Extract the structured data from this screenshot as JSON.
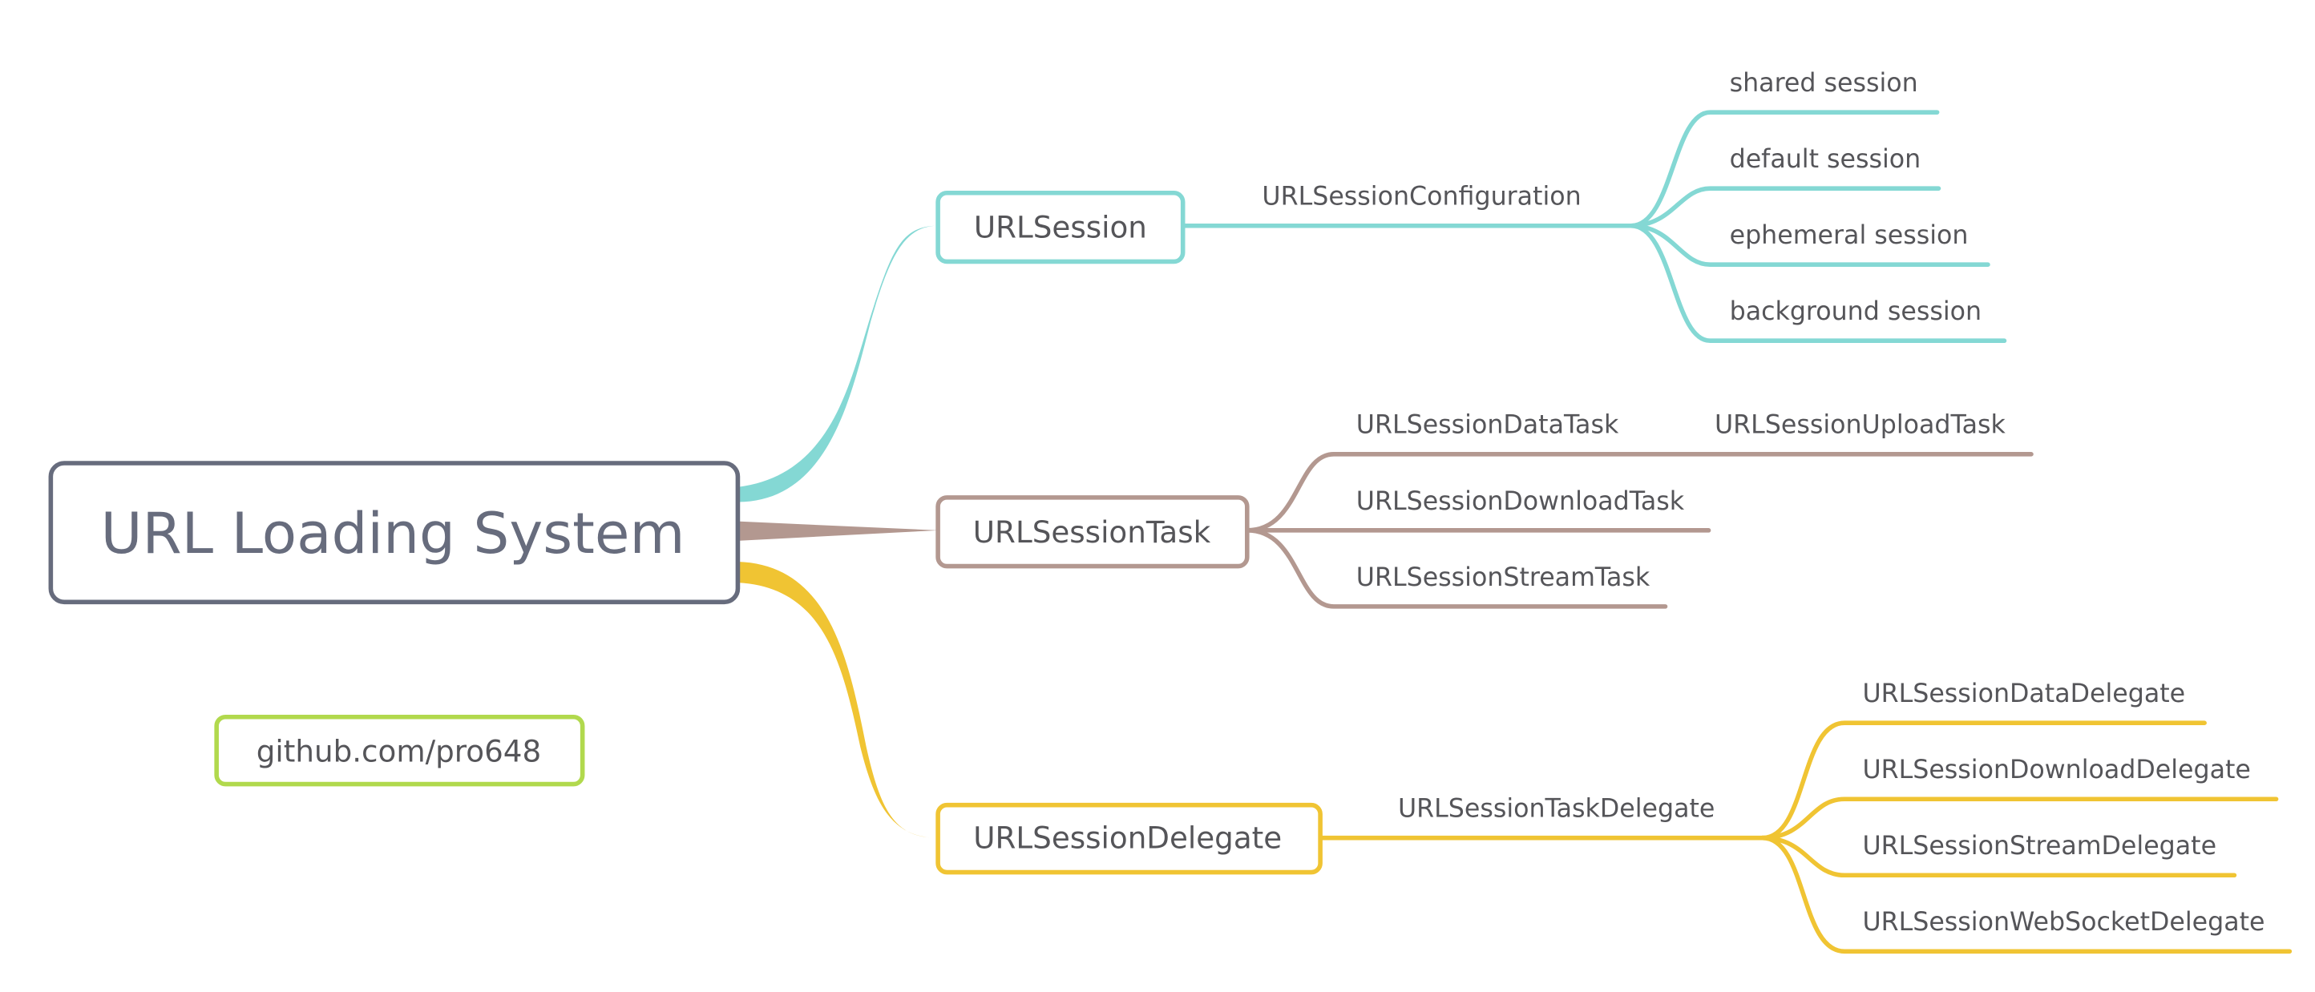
{
  "title": "URL Loading System",
  "colors": {
    "root": "#676C7D",
    "urlsession": "#84D8D4",
    "task": "#B39890",
    "delegate": "#F0C433",
    "floating": "#B1D94D",
    "text": "#555559"
  },
  "root": {
    "label": "URL Loading System"
  },
  "floating": {
    "label": "github.com/pro648"
  },
  "branches": [
    {
      "label": "URLSession",
      "children": [
        {
          "label": "URLSessionConfiguration",
          "children": [
            {
              "label": "shared session"
            },
            {
              "label": "default session"
            },
            {
              "label": "ephemeral session"
            },
            {
              "label": "background session"
            }
          ]
        }
      ]
    },
    {
      "label": "URLSessionTask",
      "children": [
        {
          "label": "URLSessionDataTask",
          "children": [
            {
              "label": "URLSessionUploadTask"
            }
          ]
        },
        {
          "label": "URLSessionDownloadTask"
        },
        {
          "label": "URLSessionStreamTask"
        }
      ]
    },
    {
      "label": "URLSessionDelegate",
      "children": [
        {
          "label": "URLSessionTaskDelegate",
          "children": [
            {
              "label": "URLSessionDataDelegate"
            },
            {
              "label": "URLSessionDownloadDelegate"
            },
            {
              "label": "URLSessionStreamDelegate"
            },
            {
              "label": "URLSessionWebSocketDelegate"
            }
          ]
        }
      ]
    }
  ]
}
